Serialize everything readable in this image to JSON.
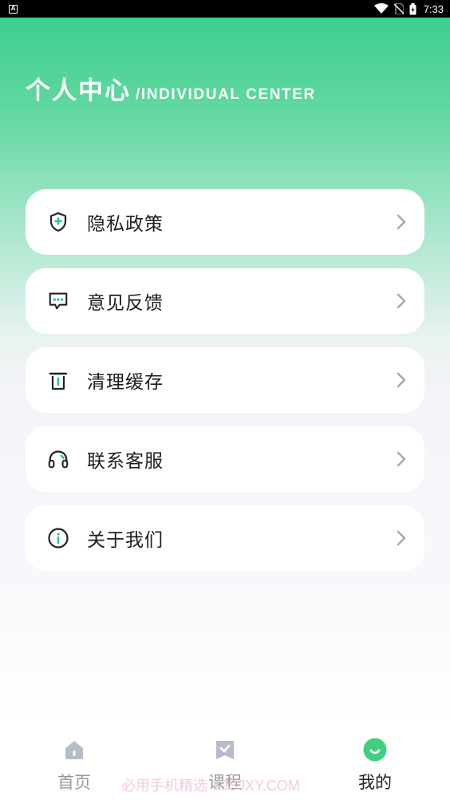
{
  "status_bar": {
    "app_icon": "A",
    "time": "7:33"
  },
  "header": {
    "title": "个人中心",
    "subtitle": "/INDIVIDUAL CENTER"
  },
  "menu": [
    {
      "label": "隐私政策",
      "icon": "shield-plus-icon"
    },
    {
      "label": "意见反馈",
      "icon": "message-dots-icon"
    },
    {
      "label": "清理缓存",
      "icon": "trash-icon"
    },
    {
      "label": "联系客服",
      "icon": "headset-icon"
    },
    {
      "label": "关于我们",
      "icon": "info-circle-icon"
    }
  ],
  "tabs": [
    {
      "label": "首页",
      "icon": "home-icon",
      "active": false
    },
    {
      "label": "课程",
      "icon": "course-check-icon",
      "active": false
    },
    {
      "label": "我的",
      "icon": "smile-icon",
      "active": true
    }
  ],
  "watermark": "必用手机精选 YJSJXY.COM",
  "colors": {
    "accent": "#3ecf8e",
    "tab_inactive": "#999999",
    "icon_inactive": "#b7bccb"
  }
}
